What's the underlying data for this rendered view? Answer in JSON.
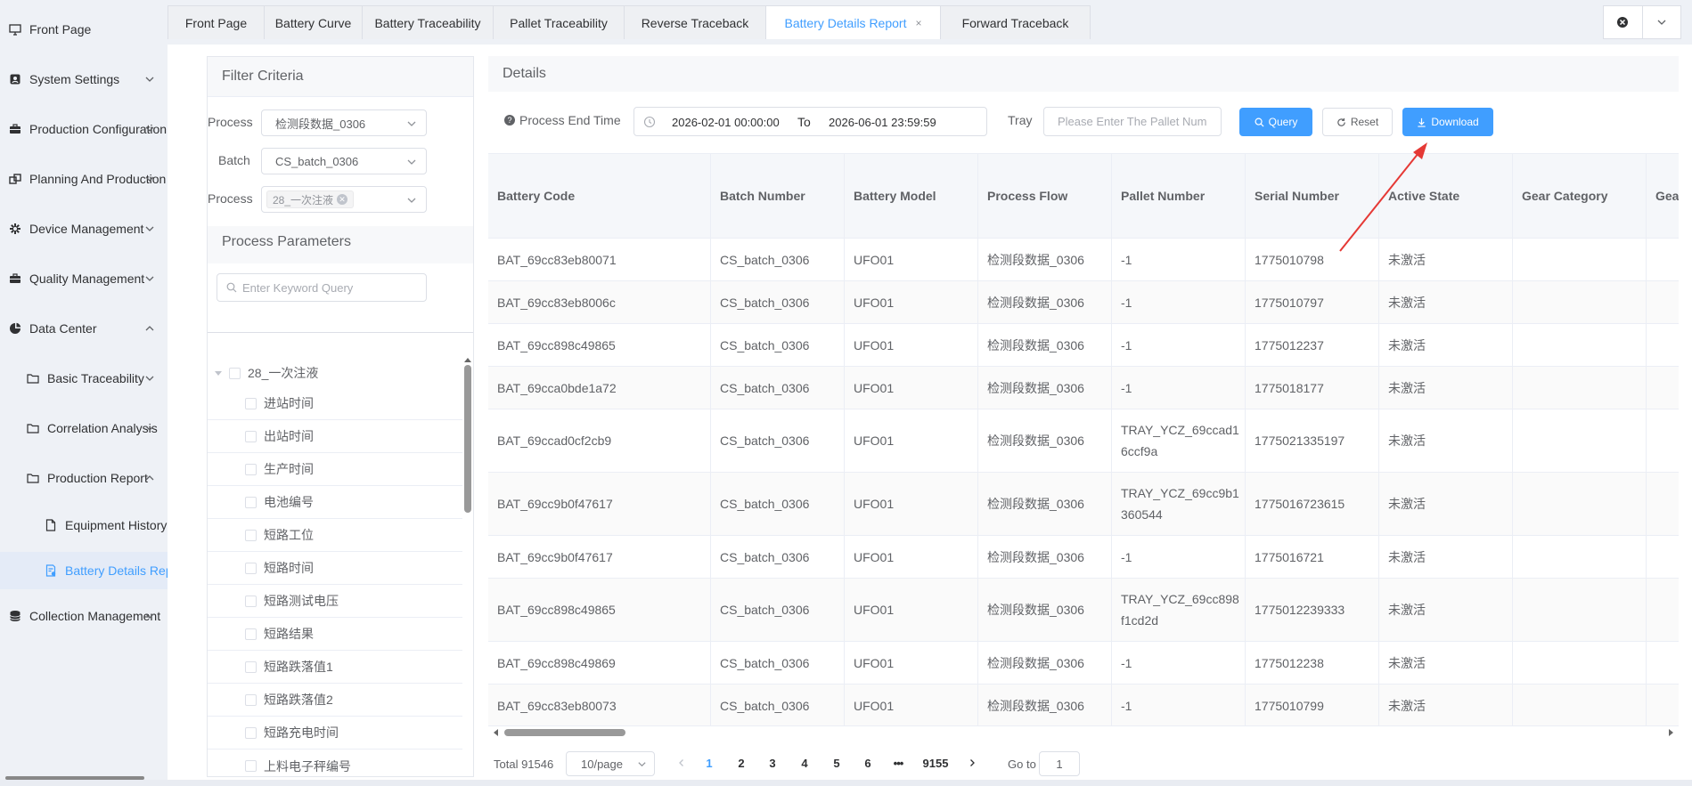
{
  "sidebar": {
    "items": [
      {
        "label": "Front Page",
        "icon": "monitor-icon"
      },
      {
        "label": "System Settings",
        "icon": "settings-icon"
      },
      {
        "label": "Production Configuration",
        "icon": "briefcase-icon"
      },
      {
        "label": "Planning And Production",
        "icon": "planning-icon"
      },
      {
        "label": "Device Management",
        "icon": "gear-icon"
      },
      {
        "label": "Quality Management",
        "icon": "briefcase-icon"
      },
      {
        "label": "Data Center",
        "icon": "pie-chart-icon"
      },
      {
        "label": "Basic Traceability",
        "icon": "folder-icon"
      },
      {
        "label": "Correlation Analysis",
        "icon": "folder-icon"
      },
      {
        "label": "Production Report",
        "icon": "folder-icon"
      },
      {
        "label": "Equipment History",
        "icon": "document-icon"
      },
      {
        "label": "Battery Details Report",
        "icon": "report-icon"
      },
      {
        "label": "Collection Management",
        "icon": "database-icon"
      }
    ]
  },
  "tabs": [
    {
      "label": "Front Page"
    },
    {
      "label": "Battery Curve"
    },
    {
      "label": "Battery Traceability"
    },
    {
      "label": "Pallet Traceability"
    },
    {
      "label": "Reverse Traceback"
    },
    {
      "label": "Battery Details Report",
      "close": "×"
    },
    {
      "label": "Forward Traceback"
    }
  ],
  "filter": {
    "title": "Filter Criteria",
    "process_label": "Process",
    "process_value": "检测段数据_0306",
    "batch_label": "Batch",
    "batch_value": "CS_batch_0306",
    "process2_label": "Process",
    "process2_tag": "28_一次注液",
    "params_title": "Process Parameters",
    "keyword_placeholder": "Enter Keyword Query",
    "tree_root": "28_一次注液",
    "tree_items": [
      "进站时间",
      "出站时间",
      "生产时间",
      "电池编号",
      "短路工位",
      "短路时间",
      "短路测试电压",
      "短路结果",
      "短路跌落值1",
      "短路跌落值2",
      "短路充电时间",
      "上料电子秤编号"
    ]
  },
  "details": {
    "title": "Details",
    "time_label": "Process End Time",
    "date_start": "2026-02-01 00:00:00",
    "date_to": "To",
    "date_end": "2026-06-01 23:59:59",
    "tray_label": "Tray",
    "tray_placeholder": "Please Enter The Pallet Num",
    "query_label": "Query",
    "reset_label": "Reset",
    "download_label": "Download"
  },
  "table": {
    "columns": [
      "Battery Code",
      "Batch Number",
      "Battery Model",
      "Process Flow",
      "Pallet Number",
      "Serial Number",
      "Active State",
      "Gear Category",
      "Gea"
    ],
    "rows": [
      [
        "BAT_69cc83eb80071",
        "CS_batch_0306",
        "UFO01",
        "检测段数据_0306",
        "-1",
        "1775010798",
        "未激活",
        "",
        ""
      ],
      [
        "BAT_69cc83eb8006c",
        "CS_batch_0306",
        "UFO01",
        "检测段数据_0306",
        "-1",
        "1775010797",
        "未激活",
        "",
        ""
      ],
      [
        "BAT_69cc898c49865",
        "CS_batch_0306",
        "UFO01",
        "检测段数据_0306",
        "-1",
        "1775012237",
        "未激活",
        "",
        ""
      ],
      [
        "BAT_69cca0bde1a72",
        "CS_batch_0306",
        "UFO01",
        "检测段数据_0306",
        "-1",
        "1775018177",
        "未激活",
        "",
        ""
      ],
      [
        "BAT_69ccad0cf2cb9",
        "CS_batch_0306",
        "UFO01",
        "检测段数据_0306",
        "TRAY_YCZ_69ccad16ccf9a",
        "1775021335197",
        "未激活",
        "",
        ""
      ],
      [
        "BAT_69cc9b0f47617",
        "CS_batch_0306",
        "UFO01",
        "检测段数据_0306",
        "TRAY_YCZ_69cc9b1360544",
        "1775016723615",
        "未激活",
        "",
        ""
      ],
      [
        "BAT_69cc9b0f47617",
        "CS_batch_0306",
        "UFO01",
        "检测段数据_0306",
        "-1",
        "1775016721",
        "未激活",
        "",
        ""
      ],
      [
        "BAT_69cc898c49865",
        "CS_batch_0306",
        "UFO01",
        "检测段数据_0306",
        "TRAY_YCZ_69cc898f1cd2d",
        "1775012239333",
        "未激活",
        "",
        ""
      ],
      [
        "BAT_69cc898c49869",
        "CS_batch_0306",
        "UFO01",
        "检测段数据_0306",
        "-1",
        "1775012238",
        "未激活",
        "",
        ""
      ],
      [
        "BAT_69cc83eb80073",
        "CS_batch_0306",
        "UFO01",
        "检测段数据_0306",
        "-1",
        "1775010799",
        "未激活",
        "",
        ""
      ]
    ]
  },
  "pagination": {
    "total": "Total 91546",
    "page_size": "10/page",
    "pages": [
      "1",
      "2",
      "3",
      "4",
      "5",
      "6",
      "•••",
      "9155"
    ],
    "current": "1",
    "goto_label": "Go to",
    "goto_value": "1"
  },
  "colors": {
    "accent": "#409eff",
    "annotation_arrow": "#e53935"
  }
}
